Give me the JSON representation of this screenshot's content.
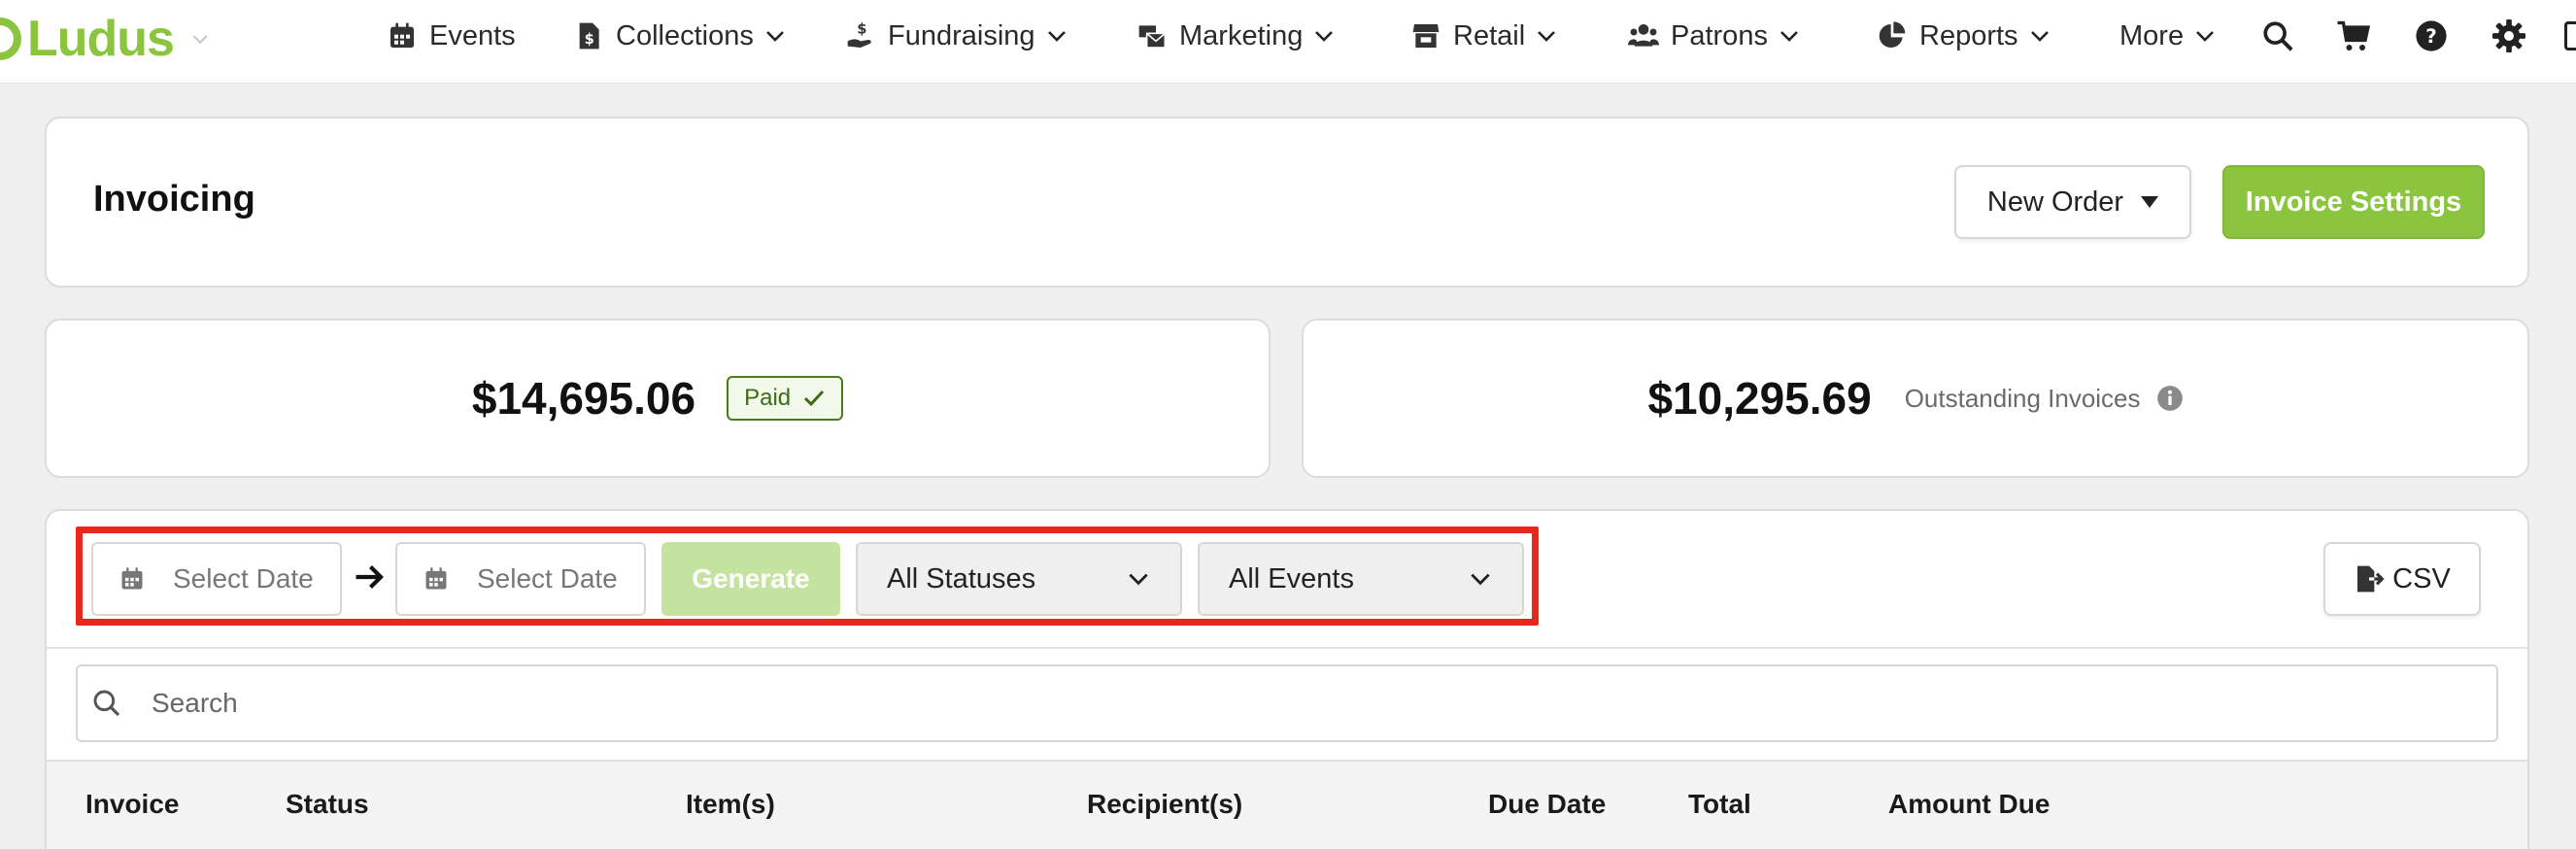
{
  "app": {
    "name": "Ludus"
  },
  "nav": {
    "events": "Events",
    "collections": "Collections",
    "fundraising": "Fundraising",
    "marketing": "Marketing",
    "retail": "Retail",
    "patrons": "Patrons",
    "reports": "Reports",
    "more": "More"
  },
  "page": {
    "title": "Invoicing",
    "new_order": "New Order",
    "invoice_settings": "Invoice Settings"
  },
  "stats": {
    "paid_amount": "$14,695.06",
    "paid_label": "Paid",
    "outstanding_amount": "$10,295.69",
    "outstanding_label": "Outstanding Invoices"
  },
  "filters": {
    "start_date_placeholder": "Select Date",
    "end_date_placeholder": "Select Date",
    "generate": "Generate",
    "status_selected": "All Statuses",
    "events_selected": "All Events",
    "csv": "CSV"
  },
  "search": {
    "placeholder": "Search"
  },
  "table": {
    "columns": [
      "Invoice",
      "Status",
      "Item(s)",
      "Recipient(s)",
      "Due Date",
      "Total",
      "Amount Due"
    ]
  },
  "colors": {
    "brand": "#8bc53f",
    "highlight": "#e8281a"
  }
}
